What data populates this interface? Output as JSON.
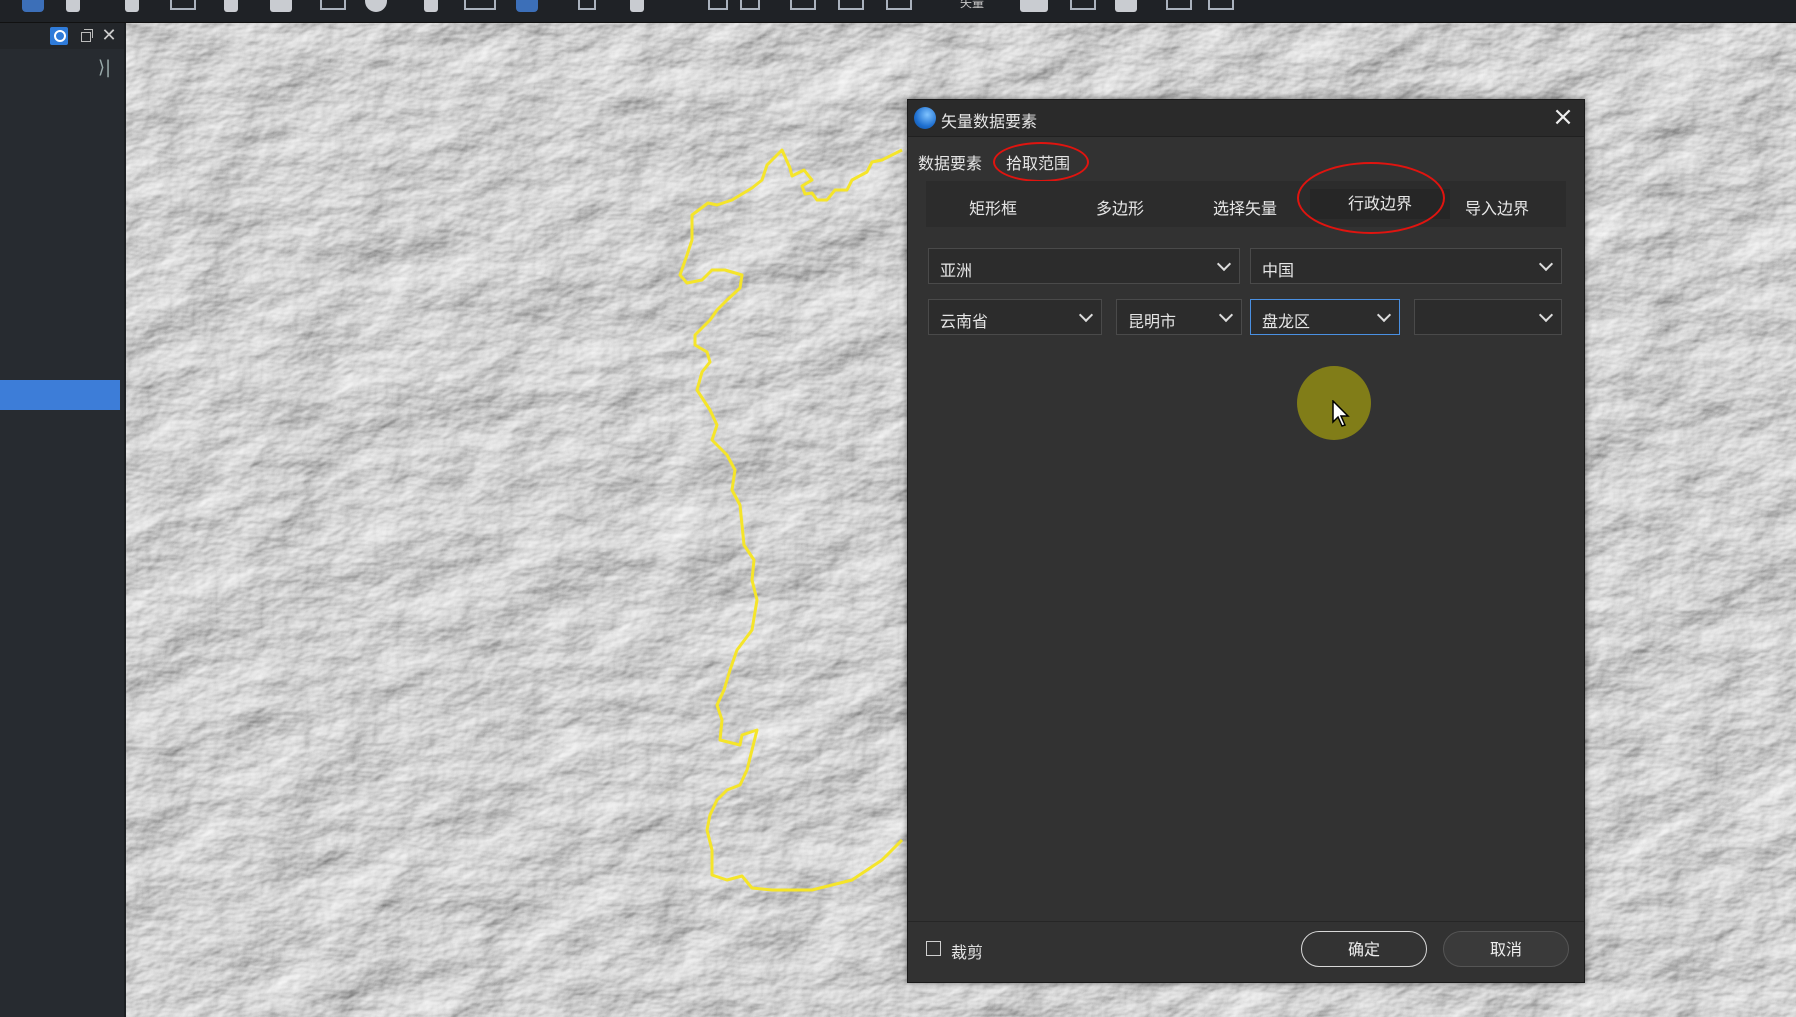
{
  "toolbar": {
    "partial_text": "矢量"
  },
  "dialog": {
    "title": "矢量数据要素",
    "tabs": [
      "数据要素",
      "拾取范围"
    ],
    "subtabs": [
      "矩形框",
      "多边形",
      "选择矢量",
      "行政边界",
      "导入边界"
    ],
    "active_subtab": "行政边界",
    "selects": {
      "continent": "亚洲",
      "country": "中国",
      "province": "云南省",
      "city": "昆明市",
      "district": "盘龙区",
      "subdistrict": ""
    },
    "clip_label": "裁剪",
    "clip_checked": false,
    "ok_label": "确定",
    "cancel_label": "取消"
  },
  "colors": {
    "accent": "#3d7dd8",
    "boundary": "#f5e52a",
    "annotation": "#e0140f"
  }
}
